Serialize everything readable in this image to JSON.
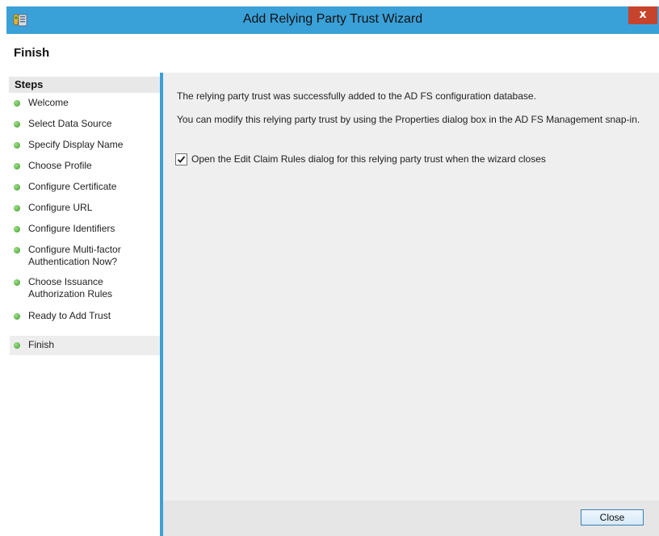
{
  "window": {
    "title": "Add Relying Party Trust Wizard",
    "close_glyph": "x"
  },
  "colors": {
    "accent": "#3aa0d8",
    "close_button": "#c7432b",
    "step_dot": "#4caf2f"
  },
  "icons": {
    "app": "adfs-trust-icon",
    "close": "close-icon",
    "step": "green-dot-icon",
    "checkbox": "checkmark-icon"
  },
  "header": {
    "title": "Finish"
  },
  "sidebar": {
    "title": "Steps",
    "items": [
      {
        "label": "Welcome"
      },
      {
        "label": "Select Data Source"
      },
      {
        "label": "Specify Display Name"
      },
      {
        "label": "Choose Profile"
      },
      {
        "label": "Configure Certificate"
      },
      {
        "label": "Configure URL"
      },
      {
        "label": "Configure Identifiers"
      },
      {
        "label": "Configure Multi-factor Authentication Now?"
      },
      {
        "label": "Choose Issuance Authorization Rules"
      },
      {
        "label": "Ready to Add Trust"
      },
      {
        "label": "Finish"
      }
    ],
    "active_item": "Finish"
  },
  "main": {
    "message1": "The relying party trust was successfully added to the AD FS configuration database.",
    "message2": "You can modify this relying party trust by using the Properties dialog box in the AD FS Management snap-in.",
    "checkbox": {
      "label": "Open the Edit Claim Rules dialog for this relying party trust when the wizard closes",
      "checked": true
    }
  },
  "footer": {
    "close_label": "Close"
  }
}
